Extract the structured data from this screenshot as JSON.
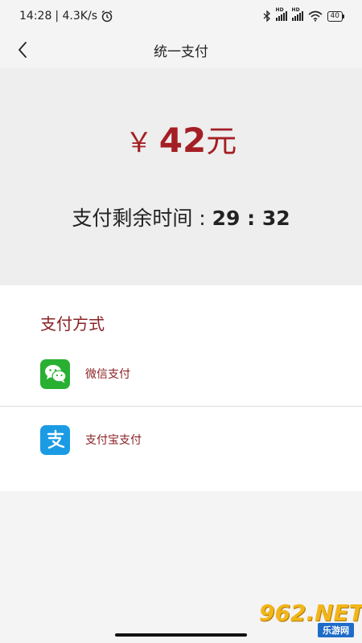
{
  "status_bar": {
    "time": "14:28",
    "speed": "| 4.3K/s",
    "hd": "HD",
    "battery": "40"
  },
  "nav": {
    "title": "统一支付"
  },
  "amount": {
    "currency_symbol": "￥",
    "value": "42",
    "unit": "元"
  },
  "timer": {
    "label": "支付剩余时间 : ",
    "time": "29 : 32"
  },
  "payment": {
    "heading": "支付方式",
    "methods": [
      {
        "label": "微信支付",
        "icon": "wechat-icon"
      },
      {
        "label": "支付宝支付",
        "icon": "alipay-icon"
      }
    ]
  },
  "watermark": {
    "logo_text": "962.NET",
    "sub_text": "乐游网"
  },
  "colors": {
    "accent": "#a41f24",
    "label": "#8b2226",
    "wechat": "#29b033",
    "alipay": "#1a9be4"
  }
}
